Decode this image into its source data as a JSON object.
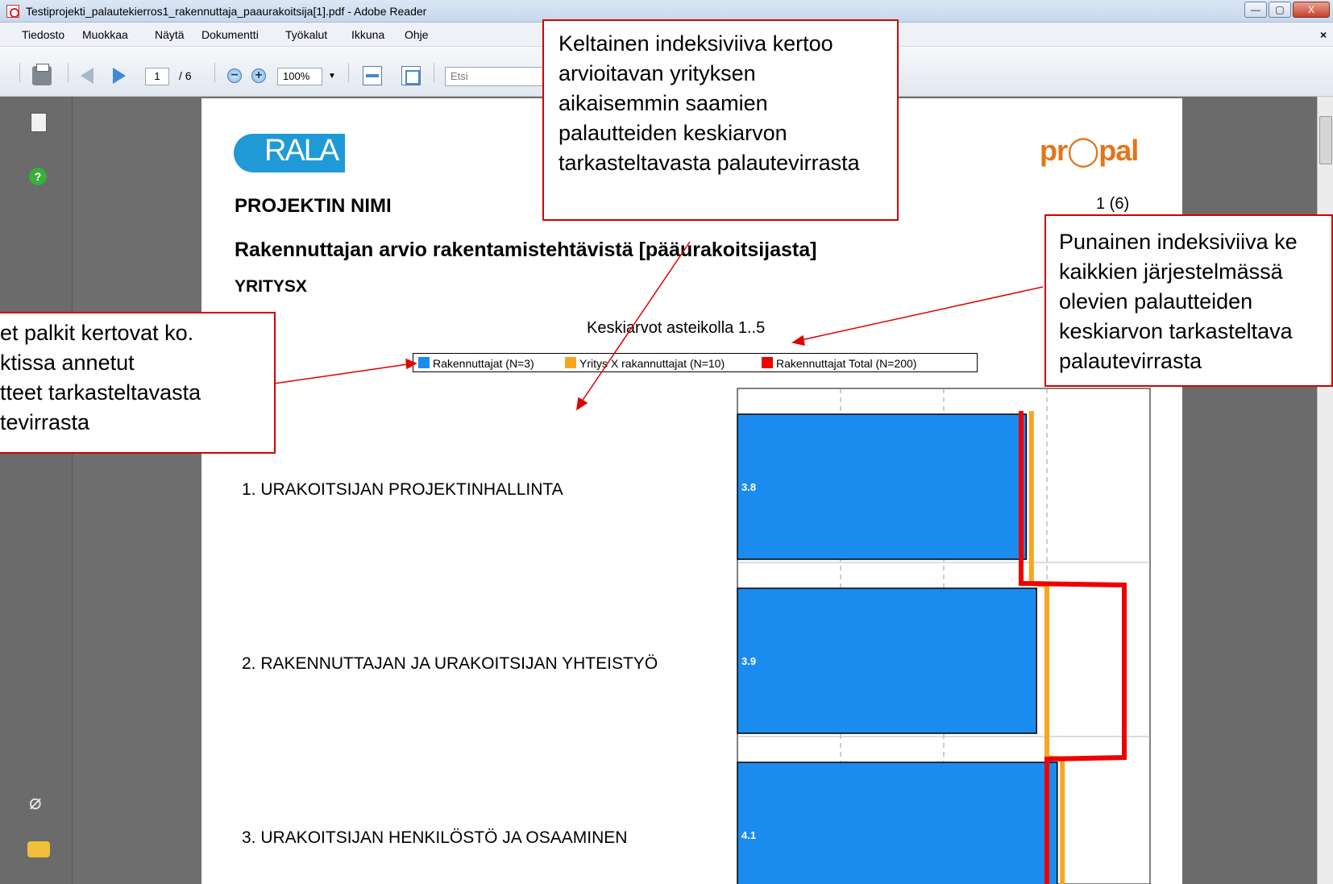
{
  "window": {
    "title": "Testiprojekti_palautekierros1_rakennuttaja_paaurakoitsija[1].pdf - Adobe Reader",
    "buttons": {
      "minimize": "—",
      "maximize": "▢",
      "close": "X"
    }
  },
  "menu": [
    "Tiedosto",
    "Muokkaa",
    "Näytä",
    "Dokumentti",
    "Työkalut",
    "Ikkuna",
    "Ohje"
  ],
  "menu_close": "×",
  "toolbar": {
    "page_current": "1",
    "page_total": "/ 6",
    "zoom": "100%",
    "search_placeholder": "Etsi"
  },
  "nav_icons": [
    "pages-icon",
    "help-icon",
    "attachment-icon",
    "comment-icon"
  ],
  "document": {
    "logo_left": "RALA",
    "logo_right": "pr◯pal",
    "project_name": "PROJEKTIN NIMI",
    "page_no": "1 (6)",
    "report_title": "Rakennuttajan arvio rakentamistehtävistä [pääurakoitsijasta]",
    "company": "YRITYSX"
  },
  "chart_data": {
    "type": "bar",
    "title": "Keskiarvot asteikolla 1..5",
    "orientation": "horizontal",
    "categories": [
      "1. URAKOITSIJAN PROJEKTINHALLINTA",
      "2. RAKENNUTTAJAN JA URAKOITSIJAN YHTEISTYÖ",
      "3. URAKOITSIJAN HENKILÖSTÖ JA OSAAMINEN"
    ],
    "series": [
      {
        "name": "Rakennuttajat (N=3)",
        "type": "bar",
        "color": "#1a8cf0",
        "values": [
          3.8,
          3.9,
          4.1
        ]
      },
      {
        "name": "Yritys X rakannuttajat (N=10)",
        "type": "index-line",
        "color": "#f7a623",
        "values": [
          3.85,
          4.0,
          4.15
        ]
      },
      {
        "name": "Rakennuttajat Total (N=200)",
        "type": "index-line",
        "color": "#ee0000",
        "values": [
          3.75,
          4.75,
          4.0
        ]
      }
    ],
    "bar_labels": [
      "3.8",
      "3.9",
      "4.1"
    ],
    "xlim": [
      1,
      5
    ],
    "grid": true,
    "legend": "top"
  },
  "callouts": {
    "yellow": "Keltainen indeksiviiva kertoo arvioitavan yrityksen aikaisemmin saamien palautteiden keskiarvon tarkasteltavasta palautevirrasta",
    "red": [
      "Punainen indeksiviiva ke",
      "kaikkien järjestelmässä",
      "olevien palautteiden",
      "keskiarvon tarkasteltava",
      "palautevirrasta"
    ],
    "blue": [
      "et palkit kertovat ko.",
      "ktissa annetut",
      "tteet tarkasteltavasta",
      "tevirrasta"
    ]
  },
  "colors": {
    "callout_border": "#d40000",
    "arrow": "#e00000",
    "bar": "#1a8cf0",
    "orange": "#f7a623",
    "red": "#ee0000"
  }
}
